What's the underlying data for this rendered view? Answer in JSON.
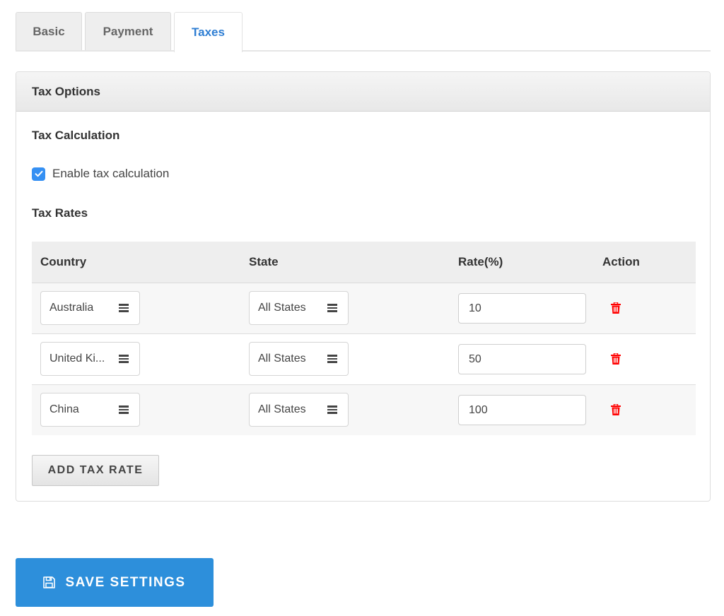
{
  "tabs": [
    {
      "label": "Basic",
      "active": false
    },
    {
      "label": "Payment",
      "active": false
    },
    {
      "label": "Taxes",
      "active": true
    }
  ],
  "panel": {
    "title": "Tax Options",
    "tax_calculation": {
      "heading": "Tax Calculation",
      "checkbox_label": "Enable tax calculation",
      "checked": true
    },
    "tax_rates": {
      "heading": "Tax Rates",
      "columns": [
        "Country",
        "State",
        "Rate(%)",
        "Action"
      ],
      "rows": [
        {
          "country": "Australia",
          "state": "All States",
          "rate": "10"
        },
        {
          "country": "United Ki...",
          "state": "All States",
          "rate": "50"
        },
        {
          "country": "China",
          "state": "All States",
          "rate": "100"
        }
      ],
      "add_button": "ADD TAX RATE"
    }
  },
  "save_button": {
    "label": "SAVE SETTINGS",
    "icon": "floppy-disk-icon"
  },
  "colors": {
    "accent": "#2e7ed3",
    "save_button": "#2d8fdb",
    "checkbox": "#3590f3",
    "delete_icon": "#ff0000"
  }
}
